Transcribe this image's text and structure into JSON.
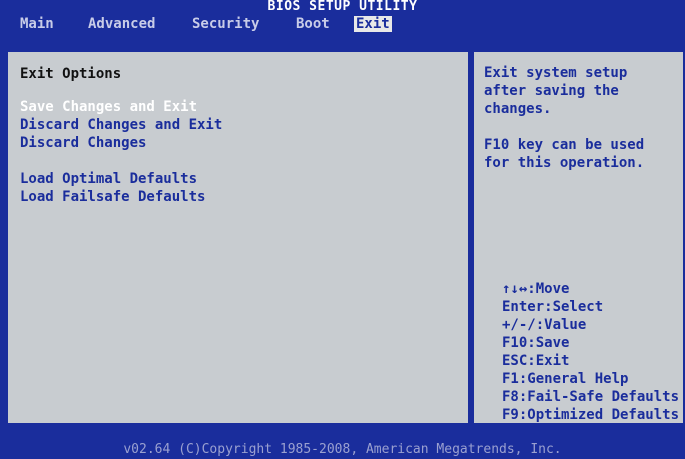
{
  "title": "BIOS SETUP UTILITY",
  "menu": [
    {
      "label": "Main"
    },
    {
      "label": "Advanced"
    },
    {
      "label": "Security"
    },
    {
      "label": "Boot"
    },
    {
      "label": "Exit"
    }
  ],
  "active_menu": "Exit",
  "exit": {
    "section_title": "Exit Options",
    "options": [
      {
        "label": "Save Changes and Exit"
      },
      {
        "label": "Discard Changes and Exit"
      },
      {
        "label": "Discard Changes"
      },
      {
        "label": "Load Optimal Defaults"
      },
      {
        "label": "Load Failsafe Defaults"
      }
    ],
    "selected": "Save Changes and Exit"
  },
  "help": {
    "lines": [
      "Exit system setup",
      "after saving the",
      "changes.",
      "",
      "F10 key can be used",
      "for this operation."
    ],
    "keys": [
      "↑↓↔:Move",
      "Enter:Select",
      "+/-/:Value",
      "F10:Save",
      "ESC:Exit",
      "F1:General Help",
      "F8:Fail-Safe Defaults",
      "F9:Optimized Defaults"
    ]
  },
  "footer": "v02.64 (C)Copyright 1985-2008, American Megatrends, Inc.",
  "colors": {
    "background": "#1a2d9c",
    "panel": "#c8ccd0",
    "highlight_text": "#ffffff",
    "menu_active_bg": "#e8e8e8"
  }
}
